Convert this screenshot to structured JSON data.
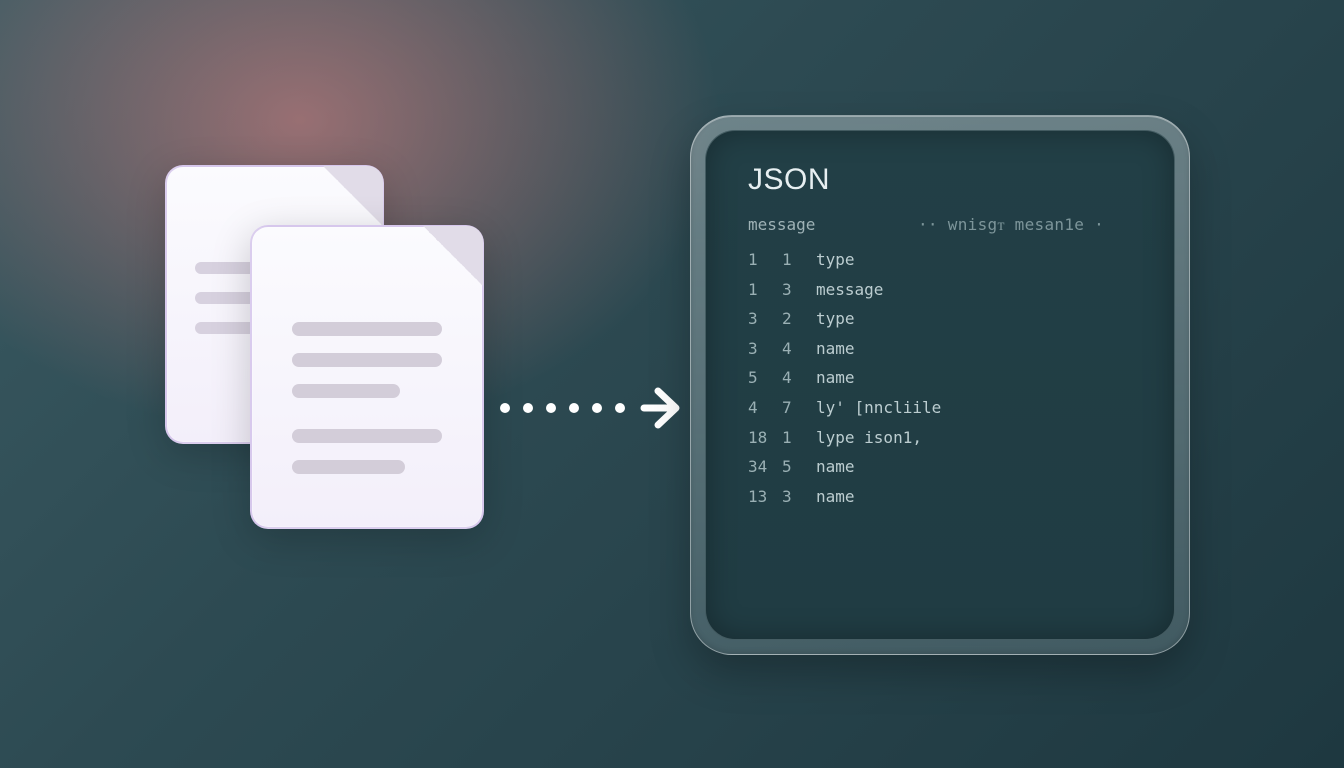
{
  "panel": {
    "title": "JSON",
    "header_left": "message",
    "header_right": "·· wnisgᴛ mesan1e ·"
  },
  "rows": [
    {
      "a": "1",
      "b": "1",
      "key": "type"
    },
    {
      "a": "1",
      "b": "3",
      "key": "message"
    },
    {
      "a": "3",
      "b": "2",
      "key": "type"
    },
    {
      "a": "3",
      "b": "4",
      "key": "name"
    },
    {
      "a": "5",
      "b": "4",
      "key": "name"
    },
    {
      "a": "4",
      "b": "7",
      "key": "ly' [nncliile"
    },
    {
      "a": "18",
      "b": "1",
      "key": "lype ison1,"
    },
    {
      "a": "34",
      "b": "5",
      "key": "name"
    },
    {
      "a": "13",
      "b": "3",
      "key": "name"
    }
  ]
}
